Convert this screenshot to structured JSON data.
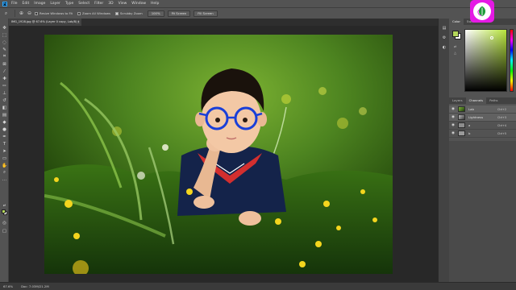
{
  "menu": {
    "logo": "Ps",
    "items": [
      "File",
      "Edit",
      "Image",
      "Layer",
      "Type",
      "Select",
      "Filter",
      "3D",
      "View",
      "Window",
      "Help"
    ]
  },
  "options": {
    "resize_windows_label": "Resize Windows to Fit",
    "zoom_all_windows_label": "Zoom All Windows",
    "scrubby_zoom_label": "Scrubby Zoom",
    "zoom_100_label": "100%",
    "fit_screen_label": "Fit Screen",
    "fill_screen_label": "Fill Screen"
  },
  "document": {
    "tab_title": "IMG_1928.jpg @ 67.6% (Layer 0 copy, Lab/8) *",
    "close_glyph": "×"
  },
  "status": {
    "zoom": "67.6%",
    "doc_size": "Doc: 7.03M/21.2M"
  },
  "panels": {
    "color_tabs": [
      "Color",
      "Swatches"
    ],
    "layer_tabs": [
      "Layers",
      "Channels",
      "Paths"
    ],
    "active_layer_tab": "Channels",
    "channels": [
      {
        "name": "Lab",
        "key": "Ctrl+2"
      },
      {
        "name": "Lightness",
        "key": "Ctrl+3"
      },
      {
        "name": "a",
        "key": "Ctrl+4"
      },
      {
        "name": "b",
        "key": "Ctrl+5"
      }
    ]
  },
  "colors": {
    "foreground": "#b3d65a",
    "background": "#ffffff",
    "watermark": "#e51ae5"
  },
  "icons": {
    "eye": "eye-icon"
  }
}
